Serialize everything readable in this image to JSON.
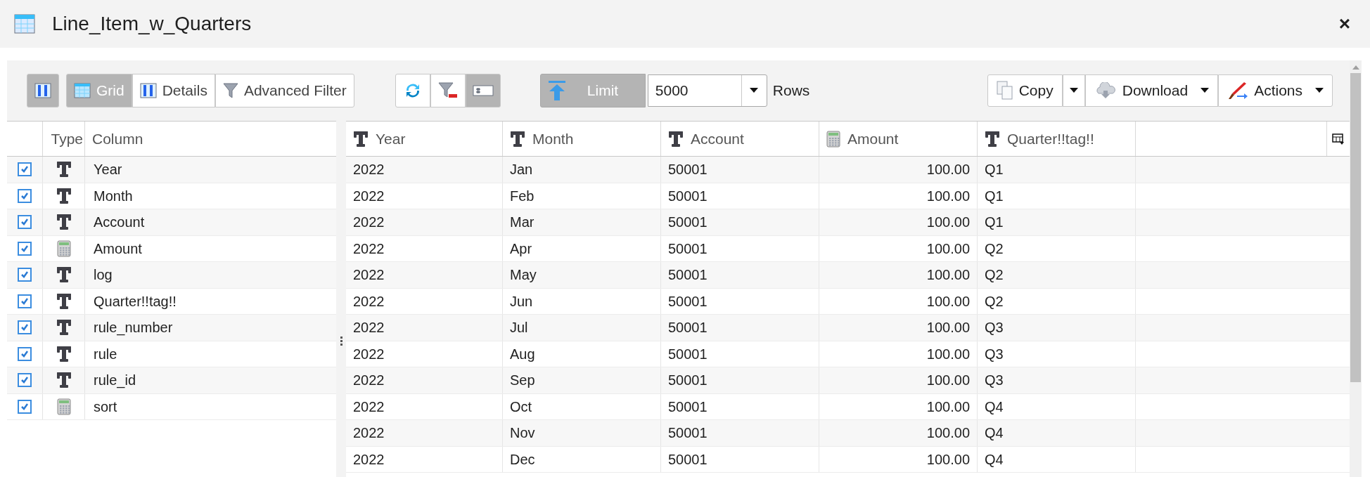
{
  "window": {
    "title": "Line_Item_w_Quarters",
    "close": "×"
  },
  "toolbar": {
    "view_buttons": [
      {
        "kind": "panel",
        "selected": true
      },
      {
        "kind": "grid",
        "label": "Grid",
        "selected": true
      },
      {
        "kind": "details",
        "label": "Details",
        "selected": false
      },
      {
        "kind": "filter",
        "label": "Advanced Filter",
        "selected": false
      }
    ],
    "tool_buttons": [
      {
        "kind": "refresh",
        "selected": false
      },
      {
        "kind": "clear-filter",
        "selected": false
      },
      {
        "kind": "row-numbers",
        "selected": true
      }
    ],
    "limit": {
      "label": "Limit",
      "selected": true,
      "value": "5000",
      "unit": "Rows"
    },
    "actions": [
      {
        "kind": "copy",
        "label": "Copy",
        "split": true
      },
      {
        "kind": "download",
        "label": "Download",
        "split": false
      },
      {
        "kind": "actions",
        "label": "Actions",
        "split": false
      }
    ]
  },
  "column_list": {
    "headers": [
      "Type",
      "Column"
    ],
    "items": [
      {
        "checked": true,
        "kind": "text",
        "name": "Year"
      },
      {
        "checked": true,
        "kind": "text",
        "name": "Month"
      },
      {
        "checked": true,
        "kind": "text",
        "name": "Account"
      },
      {
        "checked": true,
        "kind": "number",
        "name": "Amount"
      },
      {
        "checked": true,
        "kind": "text",
        "name": "log"
      },
      {
        "checked": true,
        "kind": "text",
        "name": "Quarter!!tag!!"
      },
      {
        "checked": true,
        "kind": "text",
        "name": "rule_number"
      },
      {
        "checked": true,
        "kind": "text",
        "name": "rule"
      },
      {
        "checked": true,
        "kind": "text",
        "name": "rule_id"
      },
      {
        "checked": true,
        "kind": "number",
        "name": "sort"
      }
    ]
  },
  "table": {
    "columns": [
      {
        "kind": "text",
        "label": "Year"
      },
      {
        "kind": "text",
        "label": "Month"
      },
      {
        "kind": "text",
        "label": "Account"
      },
      {
        "kind": "number",
        "label": "Amount"
      },
      {
        "kind": "text",
        "label": "Quarter!!tag!!"
      }
    ],
    "rows": [
      [
        "2022",
        "Jan",
        "50001",
        "100.00",
        "Q1"
      ],
      [
        "2022",
        "Feb",
        "50001",
        "100.00",
        "Q1"
      ],
      [
        "2022",
        "Mar",
        "50001",
        "100.00",
        "Q1"
      ],
      [
        "2022",
        "Apr",
        "50001",
        "100.00",
        "Q2"
      ],
      [
        "2022",
        "May",
        "50001",
        "100.00",
        "Q2"
      ],
      [
        "2022",
        "Jun",
        "50001",
        "100.00",
        "Q2"
      ],
      [
        "2022",
        "Jul",
        "50001",
        "100.00",
        "Q3"
      ],
      [
        "2022",
        "Aug",
        "50001",
        "100.00",
        "Q3"
      ],
      [
        "2022",
        "Sep",
        "50001",
        "100.00",
        "Q3"
      ],
      [
        "2022",
        "Oct",
        "50001",
        "100.00",
        "Q4"
      ],
      [
        "2022",
        "Nov",
        "50001",
        "100.00",
        "Q4"
      ],
      [
        "2022",
        "Dec",
        "50001",
        "100.00",
        "Q4"
      ]
    ]
  }
}
